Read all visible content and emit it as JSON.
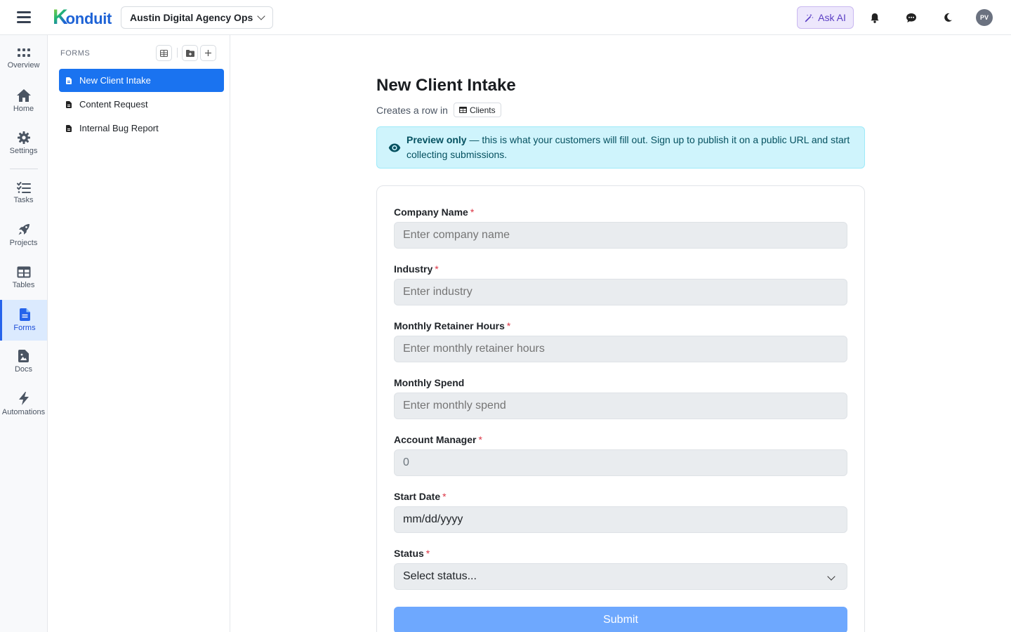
{
  "topbar": {
    "logo_text": "Konduit",
    "workspace_name": "Austin Digital Agency Ops",
    "ask_ai_label": "Ask AI",
    "avatar_initials": "PV",
    "accent_color": "#1a73f0"
  },
  "rail": {
    "items": [
      {
        "label": "Overview",
        "icon": "grid-dots-icon"
      },
      {
        "label": "Home",
        "icon": "home-icon"
      },
      {
        "label": "Settings",
        "icon": "gear-icon"
      },
      {
        "label": "Tasks",
        "icon": "checklist-icon"
      },
      {
        "label": "Projects",
        "icon": "rocket-icon"
      },
      {
        "label": "Tables",
        "icon": "table-icon"
      },
      {
        "label": "Forms",
        "icon": "document-icon",
        "active": true
      },
      {
        "label": "Docs",
        "icon": "doc-image-icon"
      },
      {
        "label": "Automations",
        "icon": "bolt-icon"
      }
    ]
  },
  "panel": {
    "heading": "FORMS",
    "forms": [
      {
        "label": "New Client Intake",
        "active": true
      },
      {
        "label": "Content Request"
      },
      {
        "label": "Internal Bug Report"
      }
    ]
  },
  "main": {
    "title": "New Client Intake",
    "creates_text": "Creates a row in",
    "table_name": "Clients",
    "preview_bold": "Preview only",
    "preview_text": " — this is what your customers will fill out. Sign up to publish it on a public URL and start collecting submissions.",
    "fields": [
      {
        "label": "Company Name",
        "required": "*",
        "placeholder": "Enter company name"
      },
      {
        "label": "Industry",
        "required": "*",
        "placeholder": "Enter industry"
      },
      {
        "label": "Monthly Retainer Hours",
        "required": "*",
        "placeholder": "Enter monthly retainer hours"
      },
      {
        "label": "Monthly Spend",
        "required": "",
        "placeholder": "Enter monthly spend"
      },
      {
        "label": "Account Manager",
        "required": "*",
        "value": "0"
      },
      {
        "label": "Start Date",
        "required": "*",
        "value": "mm/dd/yyyy"
      },
      {
        "label": "Status",
        "required": "*",
        "value": "Select status..."
      }
    ],
    "submit_label": "Submit"
  }
}
